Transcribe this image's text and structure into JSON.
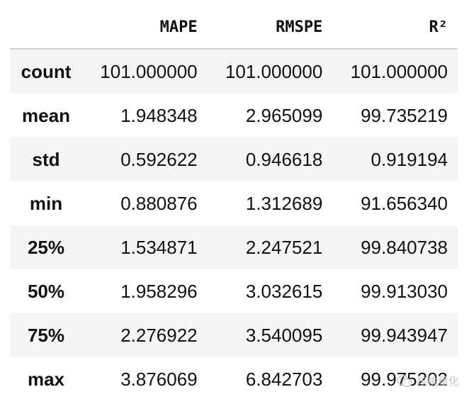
{
  "table": {
    "columns": [
      "MAPE",
      "RMSPE",
      "R²"
    ],
    "rows": [
      {
        "label": "count",
        "values": [
          "101.000000",
          "101.000000",
          "101.000000"
        ]
      },
      {
        "label": "mean",
        "values": [
          "1.948348",
          "2.965099",
          "99.735219"
        ]
      },
      {
        "label": "std",
        "values": [
          "0.592622",
          "0.946618",
          "0.919194"
        ]
      },
      {
        "label": "min",
        "values": [
          "0.880876",
          "1.312689",
          "91.656340"
        ]
      },
      {
        "label": "25%",
        "values": [
          "1.534871",
          "2.247521",
          "99.840738"
        ]
      },
      {
        "label": "50%",
        "values": [
          "1.958296",
          "3.032615",
          "99.913030"
        ]
      },
      {
        "label": "75%",
        "values": [
          "2.276922",
          "3.540095",
          "99.943947"
        ]
      },
      {
        "label": "max",
        "values": [
          "3.876069",
          "6.842703",
          "99.975202"
        ]
      }
    ]
  },
  "watermark": {
    "text": "核桃量化",
    "icon": "wechat-icon"
  }
}
